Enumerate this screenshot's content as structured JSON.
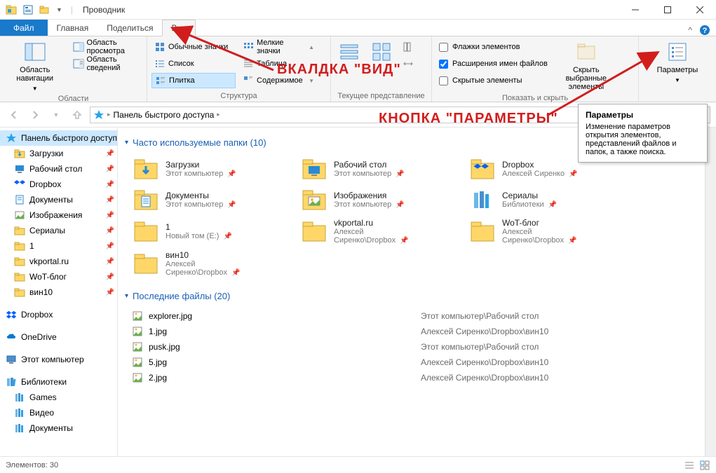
{
  "titlebar": {
    "title": "Проводник"
  },
  "tabs": {
    "file": "Файл",
    "items": [
      "Главная",
      "Поделиться",
      "Вид"
    ],
    "active_index": 2
  },
  "ribbon": {
    "groups": {
      "panes": {
        "label": "Области",
        "nav_pane": "Область навигации",
        "preview": "Область просмотра",
        "details": "Область сведений"
      },
      "layout": {
        "label": "Структура",
        "items": [
          "Обычные значки",
          "Мелкие значки",
          "Список",
          "Таблица",
          "Плитка",
          "Содержимое"
        ],
        "selected_index": 4
      },
      "current_view": {
        "label": "Текущее представление"
      },
      "show": {
        "label": "Показать и скрыть",
        "flags": "Флажки элементов",
        "ext": "Расширения имен файлов",
        "hidden": "Скрытые элементы",
        "flags_checked": false,
        "ext_checked": true,
        "hidden_checked": false,
        "hide_selected": "Скрыть выбранные элементы"
      },
      "options": {
        "label": "Параметры"
      }
    }
  },
  "breadcrumb": {
    "root": "Панель быстрого доступа"
  },
  "sidebar": {
    "quick_access": "Панель быстрого доступа",
    "items": [
      {
        "name": "Загрузки",
        "icon": "download"
      },
      {
        "name": "Рабочий стол",
        "icon": "desktop"
      },
      {
        "name": "Dropbox",
        "icon": "dropbox"
      },
      {
        "name": "Документы",
        "icon": "documents"
      },
      {
        "name": "Изображения",
        "icon": "pictures"
      },
      {
        "name": "Сериалы",
        "icon": "folder"
      },
      {
        "name": "1",
        "icon": "folder"
      },
      {
        "name": "vkportal.ru",
        "icon": "folder"
      },
      {
        "name": "WoT-блог",
        "icon": "folder"
      },
      {
        "name": "вин10",
        "icon": "folder"
      }
    ],
    "dropbox": "Dropbox",
    "onedrive": "OneDrive",
    "this_pc": "Этот компьютер",
    "libraries": "Библиотеки",
    "lib_items": [
      {
        "name": "Games"
      },
      {
        "name": "Видео"
      },
      {
        "name": "Документы"
      }
    ]
  },
  "sections": {
    "frequent": {
      "title": "Часто используемые папки (10)"
    },
    "recent": {
      "title": "Последние файлы (20)"
    }
  },
  "folders": [
    {
      "name": "Загрузки",
      "sub": "Этот компьютер",
      "icon": "download"
    },
    {
      "name": "Рабочий стол",
      "sub": "Этот компьютер",
      "icon": "desktop"
    },
    {
      "name": "Dropbox",
      "sub": "Алексей Сиренко",
      "icon": "dropbox"
    },
    {
      "name": "Документы",
      "sub": "Этот компьютер",
      "icon": "documents"
    },
    {
      "name": "Изображения",
      "sub": "Этот компьютер",
      "icon": "pictures"
    },
    {
      "name": "Сериалы",
      "sub": "Библиотеки",
      "icon": "library"
    },
    {
      "name": "1",
      "sub": "Новый том (E:)",
      "icon": "folder"
    },
    {
      "name": "vkportal.ru",
      "sub": "Алексей Сиренко\\Dropbox",
      "icon": "folder"
    },
    {
      "name": "WoT-блог",
      "sub": "Алексей Сиренко\\Dropbox",
      "icon": "folder"
    },
    {
      "name": "вин10",
      "sub": "Алексей Сиренко\\Dropbox",
      "icon": "folder"
    }
  ],
  "files": [
    {
      "name": "explorer.jpg",
      "loc": "Этот компьютер\\Рабочий стол"
    },
    {
      "name": "1.jpg",
      "loc": "Алексей Сиренко\\Dropbox\\вин10"
    },
    {
      "name": "pusk.jpg",
      "loc": "Этот компьютер\\Рабочий стол"
    },
    {
      "name": "5.jpg",
      "loc": "Алексей Сиренко\\Dropbox\\вин10"
    },
    {
      "name": "2.jpg",
      "loc": "Алексей Сиренко\\Dropbox\\вин10"
    }
  ],
  "statusbar": {
    "count": "Элементов: 30"
  },
  "annotations": {
    "tab_label": "ВКАЛДКА \"ВИД\"",
    "options_label": "КНОПКА \"ПАРАМЕТРЫ\""
  },
  "tooltip": {
    "title": "Параметры",
    "body": "Изменение параметров открытия элементов, представлений файлов и папок, а также поиска."
  }
}
